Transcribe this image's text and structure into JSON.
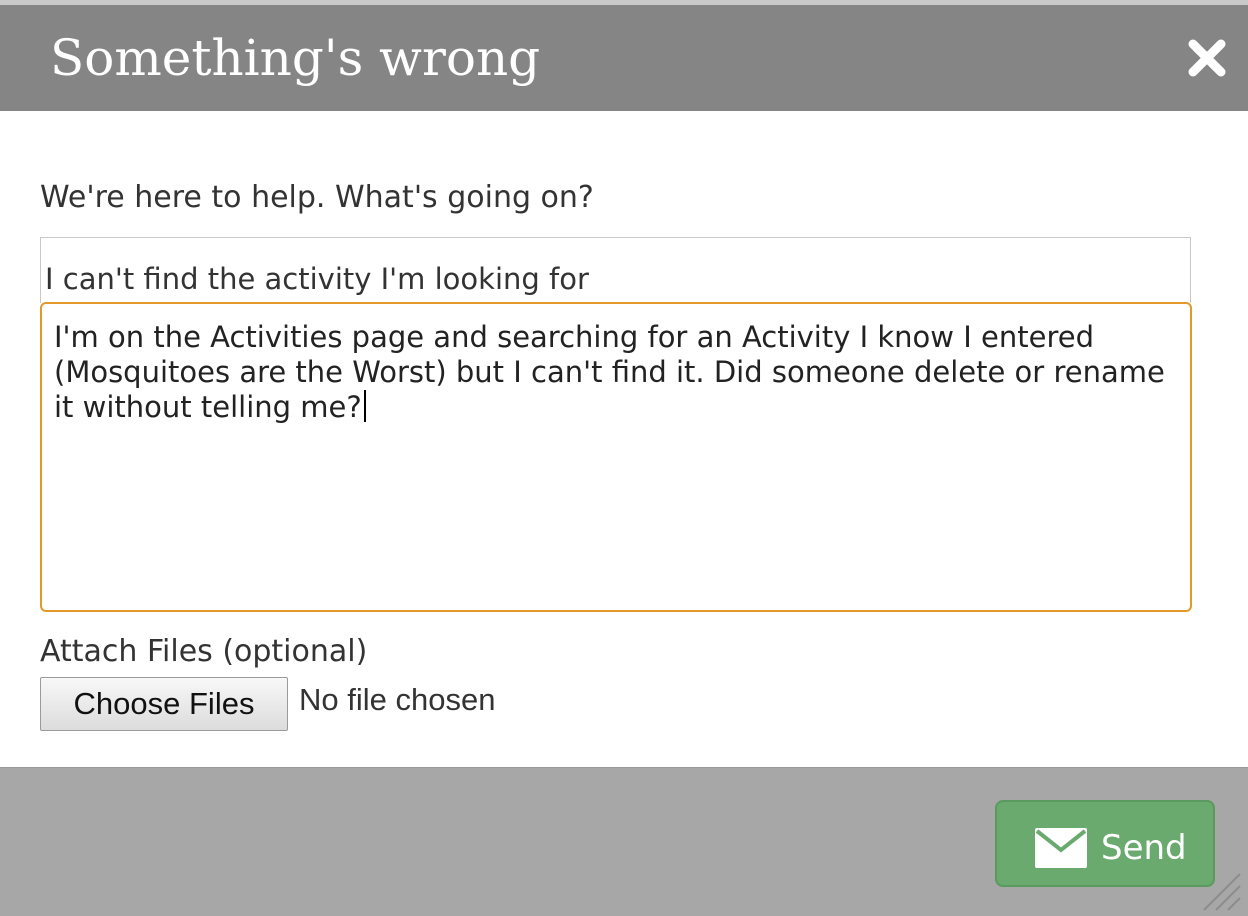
{
  "dialog": {
    "title": "Something's wrong",
    "close_icon": "close-icon"
  },
  "form": {
    "prompt": "We're here to help. What's going on?",
    "subject_value": "I can't find the activity I'm looking for",
    "message_value": "I'm on the Activities page and searching for an Activity I know I entered (Mosquitoes are the Worst) but I can't find it. Did someone delete or rename it without telling me?",
    "attach_label": "Attach Files (optional)",
    "choose_files_label": "Choose Files",
    "no_file_text": "No file chosen"
  },
  "footer": {
    "send_label": "Send",
    "send_icon": "envelope-icon"
  },
  "colors": {
    "header_bg": "#858585",
    "footer_bg": "#a7a7a7",
    "focus_border": "#e39a2b",
    "send_bg": "#6aaa6f"
  }
}
